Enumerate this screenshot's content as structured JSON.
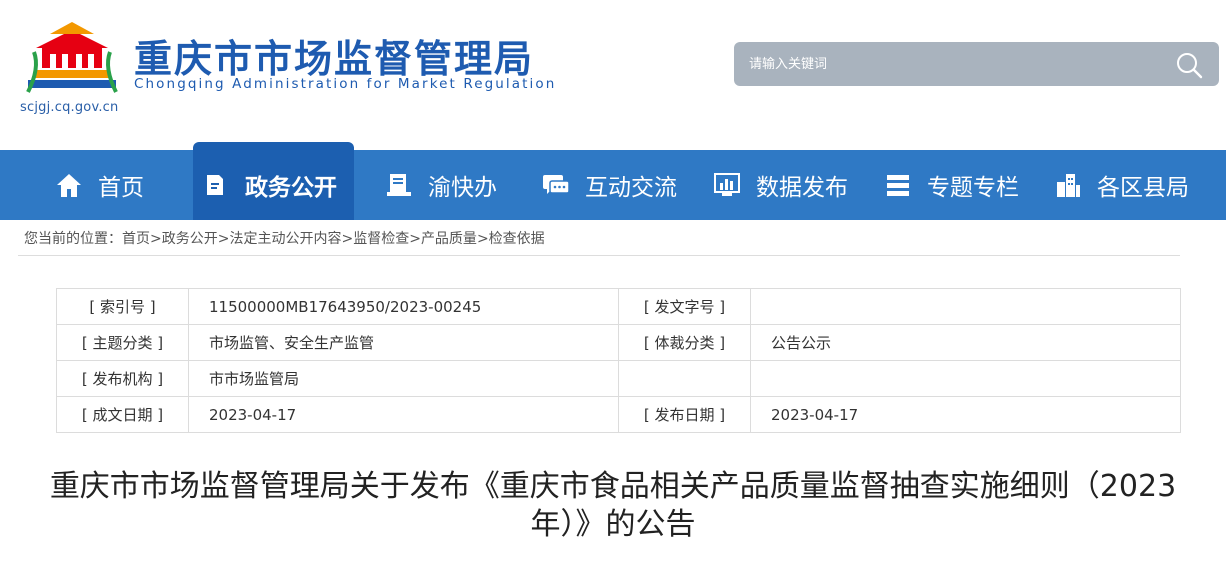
{
  "header": {
    "title": "重庆市市场监督管理局",
    "subtitle": "Chongqing  Administration for Market Regulation",
    "url": "scjgj.cq.gov.cn",
    "search_placeholder": "请输入关键词"
  },
  "nav": {
    "items": [
      {
        "label": "首页",
        "icon": "home-icon"
      },
      {
        "label": "政务公开",
        "icon": "document-icon",
        "active": true
      },
      {
        "label": "渝快办",
        "icon": "service-icon"
      },
      {
        "label": "互动交流",
        "icon": "chat-icon"
      },
      {
        "label": "数据发布",
        "icon": "chart-icon"
      },
      {
        "label": "专题专栏",
        "icon": "list-icon"
      },
      {
        "label": "各区县局",
        "icon": "buildings-icon"
      }
    ]
  },
  "breadcrumb": {
    "prefix": "您当前的位置：",
    "items": [
      "首页",
      "政务公开",
      "法定主动公开内容",
      "监督检查",
      "产品质量",
      "检查依据"
    ],
    "separator": ">"
  },
  "info": {
    "index_label": "[ 索引号 ]",
    "index_value": "11500000MB17643950/2023-00245",
    "doc_no_label": "[ 发文字号 ]",
    "doc_no_value": "",
    "topic_label": "[ 主题分类 ]",
    "topic_value": "市场监管、安全生产监管",
    "genre_label": "[ 体裁分类 ]",
    "genre_value": "公告公示",
    "issuer_label": "[ 发布机构 ]",
    "issuer_value": "市市场监管局",
    "written_label": "[ 成文日期 ]",
    "written_value": "2023-04-17",
    "publish_label": "[ 发布日期 ]",
    "publish_value": "2023-04-17"
  },
  "article": {
    "title": "重庆市市场监督管理局关于发布《重庆市食品相关产品质量监督抽查实施细则（2023年）》的公告"
  },
  "colors": {
    "brand_blue": "#1e5bb0",
    "nav_bg": "#2f79c5",
    "nav_active": "#1c5fb0",
    "search_bg": "#a9b3be"
  }
}
